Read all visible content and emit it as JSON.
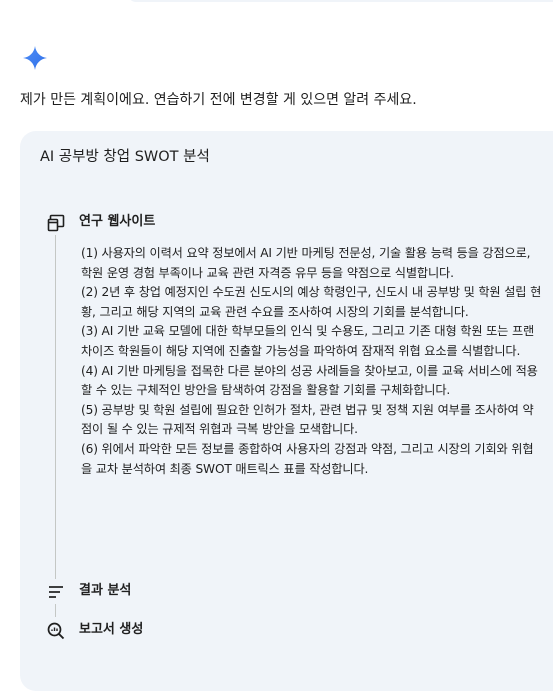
{
  "response": {
    "intro": "제가 만든 계획이에요. 연습하기 전에 변경할 게 있으면 알려 주세요."
  },
  "plan_card": {
    "title": "AI 공부방 창업 SWOT 분석",
    "steps": [
      {
        "label": "연구 웹사이트",
        "icon": "browser-window-icon",
        "items": [
          "(1) 사용자의 이력서 요약 정보에서 AI 기반 마케팅 전문성, 기술 활용 능력 등을 강점으로, 학원 운영 경험 부족이나 교육 관련 자격증 유무 등을 약점으로 식별합니다.",
          "(2) 2년 후 창업 예정지인 수도권 신도시의 예상 학령인구, 신도시 내 공부방 및 학원 설립 현황, 그리고 해당 지역의 교육 관련 수요를 조사하여 시장의 기회를 분석합니다.",
          "(3) AI 기반 교육 모델에 대한 학부모들의 인식 및 수용도, 그리고 기존 대형 학원 또는 프랜차이즈 학원들이 해당 지역에 진출할 가능성을 파악하여 잠재적 위협 요소를 식별합니다.",
          "(4) AI 기반 마케팅을 접목한 다른 분야의 성공 사례들을 찾아보고, 이를 교육 서비스에 적용할 수 있는 구체적인 방안을 탐색하여 강점을 활용할 기회를 구체화합니다.",
          "(5) 공부방 및 학원 설립에 필요한 인허가 절차, 관련 법규 및 정책 지원 여부를 조사하여 약점이 될 수 있는 규제적 위협과 극복 방안을 모색합니다.",
          "(6) 위에서 파악한 모든 정보를 종합하여 사용자의 강점과 약점, 그리고 시장의 기회와 위협을 교차 분석하여 최종 SWOT 매트릭스 표를 작성합니다."
        ]
      },
      {
        "label": "결과 분석",
        "icon": "lines-icon"
      },
      {
        "label": "보고서 생성",
        "icon": "report-search-icon"
      }
    ]
  },
  "colors": {
    "card_bg": "#f0f4f9",
    "text": "#1f1f1f",
    "line": "#c4c7c5",
    "spark": "#3b82f6"
  }
}
